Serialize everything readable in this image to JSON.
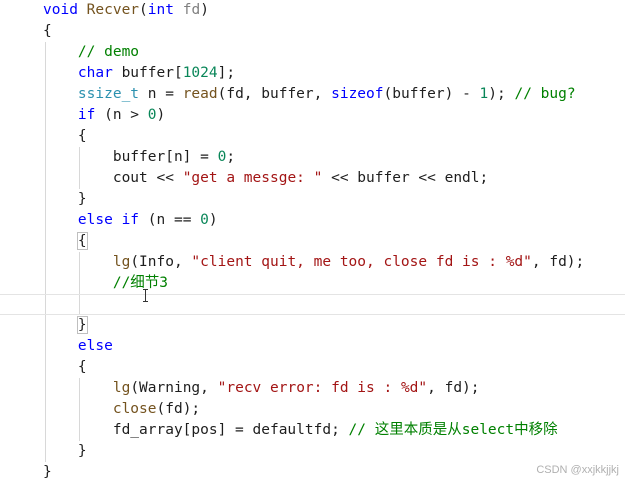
{
  "editor": {
    "lines": [
      [
        {
          "t": "void",
          "c": "kw"
        },
        {
          "t": " ",
          "c": "pl"
        },
        {
          "t": "Recver",
          "c": "fn"
        },
        {
          "t": "(",
          "c": "pl"
        },
        {
          "t": "int",
          "c": "kw"
        },
        {
          "t": " ",
          "c": "pl"
        },
        {
          "t": "fd",
          "c": "pm"
        },
        {
          "t": ")",
          "c": "pl"
        }
      ],
      [
        {
          "t": "{",
          "c": "pl"
        }
      ],
      [
        {
          "t": "    ",
          "c": "pl"
        },
        {
          "t": "// demo",
          "c": "cm"
        }
      ],
      [
        {
          "t": "    ",
          "c": "pl"
        },
        {
          "t": "char",
          "c": "kw"
        },
        {
          "t": " buffer[",
          "c": "pl"
        },
        {
          "t": "1024",
          "c": "num"
        },
        {
          "t": "];",
          "c": "pl"
        }
      ],
      [
        {
          "t": "    ",
          "c": "pl"
        },
        {
          "t": "ssize_t",
          "c": "ty"
        },
        {
          "t": " n = ",
          "c": "pl"
        },
        {
          "t": "read",
          "c": "fn"
        },
        {
          "t": "(fd, buffer, ",
          "c": "pl"
        },
        {
          "t": "sizeof",
          "c": "kw"
        },
        {
          "t": "(buffer) - ",
          "c": "pl"
        },
        {
          "t": "1",
          "c": "num"
        },
        {
          "t": "); ",
          "c": "pl"
        },
        {
          "t": "// bug?",
          "c": "cm"
        }
      ],
      [
        {
          "t": "    ",
          "c": "pl"
        },
        {
          "t": "if",
          "c": "kw"
        },
        {
          "t": " (n > ",
          "c": "pl"
        },
        {
          "t": "0",
          "c": "num"
        },
        {
          "t": ")",
          "c": "pl"
        }
      ],
      [
        {
          "t": "    {",
          "c": "pl"
        }
      ],
      [
        {
          "t": "        buffer[n] = ",
          "c": "pl"
        },
        {
          "t": "0",
          "c": "num"
        },
        {
          "t": ";",
          "c": "pl"
        }
      ],
      [
        {
          "t": "        cout << ",
          "c": "pl"
        },
        {
          "t": "\"get a messge: \"",
          "c": "str"
        },
        {
          "t": " << buffer << endl;",
          "c": "pl"
        }
      ],
      [
        {
          "t": "    }",
          "c": "pl"
        }
      ],
      [
        {
          "t": "    ",
          "c": "pl"
        },
        {
          "t": "else",
          "c": "kw"
        },
        {
          "t": " ",
          "c": "pl"
        },
        {
          "t": "if",
          "c": "kw"
        },
        {
          "t": " (n == ",
          "c": "pl"
        },
        {
          "t": "0",
          "c": "num"
        },
        {
          "t": ")",
          "c": "pl"
        }
      ],
      [
        {
          "t": "    ",
          "c": "pl"
        },
        {
          "t": "{",
          "c": "bx"
        }
      ],
      [
        {
          "t": "        ",
          "c": "pl"
        },
        {
          "t": "lg",
          "c": "fn"
        },
        {
          "t": "(Info, ",
          "c": "pl"
        },
        {
          "t": "\"client quit, me too, close fd is : %d\"",
          "c": "str"
        },
        {
          "t": ", fd);",
          "c": "pl"
        }
      ],
      [
        {
          "t": "        ",
          "c": "pl"
        },
        {
          "t": "//细节3",
          "c": "cm"
        }
      ],
      [
        {
          "t": "",
          "c": "pl"
        }
      ],
      [
        {
          "t": "    ",
          "c": "pl"
        },
        {
          "t": "}",
          "c": "bx"
        }
      ],
      [
        {
          "t": "    ",
          "c": "pl"
        },
        {
          "t": "else",
          "c": "kw"
        }
      ],
      [
        {
          "t": "    {",
          "c": "pl"
        }
      ],
      [
        {
          "t": "        ",
          "c": "pl"
        },
        {
          "t": "lg",
          "c": "fn"
        },
        {
          "t": "(Warning, ",
          "c": "pl"
        },
        {
          "t": "\"recv error: fd is : %d\"",
          "c": "str"
        },
        {
          "t": ", fd);",
          "c": "pl"
        }
      ],
      [
        {
          "t": "        ",
          "c": "pl"
        },
        {
          "t": "close",
          "c": "fn"
        },
        {
          "t": "(fd);",
          "c": "pl"
        }
      ],
      [
        {
          "t": "        fd_array[pos] = defaultfd; ",
          "c": "pl"
        },
        {
          "t": "// 这里本质是从select中移除",
          "c": "cm"
        }
      ],
      [
        {
          "t": "    }",
          "c": "pl"
        }
      ],
      [
        {
          "t": "}",
          "c": "pl"
        }
      ]
    ]
  },
  "watermark": "CSDN @xxjkkjjkj"
}
